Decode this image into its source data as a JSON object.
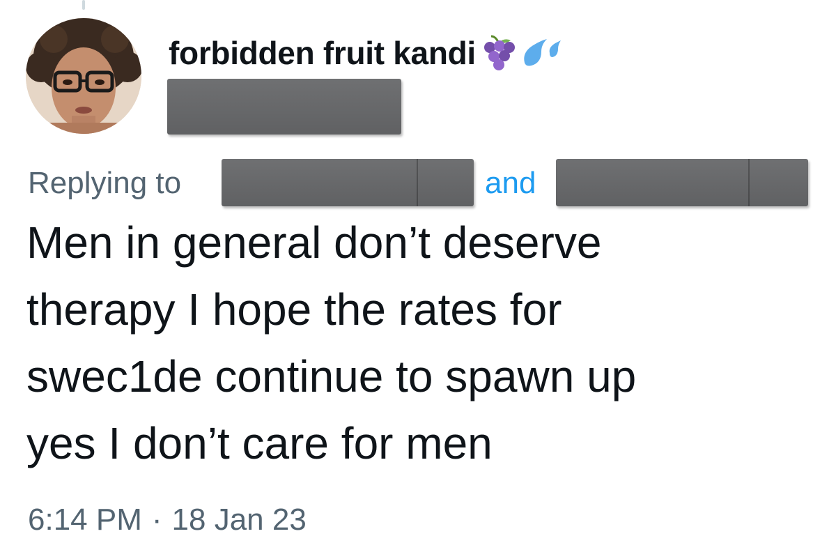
{
  "tweet": {
    "display_name": "forbidden fruit kandi",
    "name_emojis": [
      "grapes-emoji",
      "sweat-droplets-emoji"
    ],
    "reply_prefix": "Replying to",
    "reply_joiner": "and",
    "text_lines": [
      "Men in general don’t deserve",
      "therapy I hope the rates for",
      "swec1de continue to spawn up",
      "yes I don’t care for men"
    ],
    "time": "6:14 PM",
    "separator": "·",
    "date": "18 Jan 23"
  },
  "colors": {
    "text_primary": "#0f1419",
    "text_secondary": "#536471",
    "link": "#1d9bf0",
    "redaction": "#666769"
  }
}
